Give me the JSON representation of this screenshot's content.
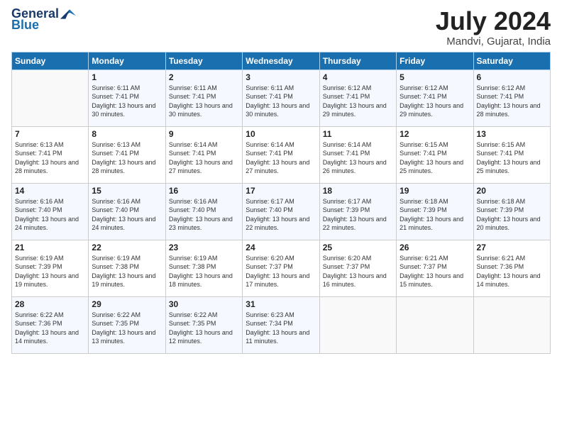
{
  "header": {
    "logo_line1": "General",
    "logo_line2": "Blue",
    "title": "July 2024",
    "location": "Mandvi, Gujarat, India"
  },
  "days_of_week": [
    "Sunday",
    "Monday",
    "Tuesday",
    "Wednesday",
    "Thursday",
    "Friday",
    "Saturday"
  ],
  "weeks": [
    [
      {
        "day": "",
        "sunrise": "",
        "sunset": "",
        "daylight": ""
      },
      {
        "day": "1",
        "sunrise": "Sunrise: 6:11 AM",
        "sunset": "Sunset: 7:41 PM",
        "daylight": "Daylight: 13 hours and 30 minutes."
      },
      {
        "day": "2",
        "sunrise": "Sunrise: 6:11 AM",
        "sunset": "Sunset: 7:41 PM",
        "daylight": "Daylight: 13 hours and 30 minutes."
      },
      {
        "day": "3",
        "sunrise": "Sunrise: 6:11 AM",
        "sunset": "Sunset: 7:41 PM",
        "daylight": "Daylight: 13 hours and 30 minutes."
      },
      {
        "day": "4",
        "sunrise": "Sunrise: 6:12 AM",
        "sunset": "Sunset: 7:41 PM",
        "daylight": "Daylight: 13 hours and 29 minutes."
      },
      {
        "day": "5",
        "sunrise": "Sunrise: 6:12 AM",
        "sunset": "Sunset: 7:41 PM",
        "daylight": "Daylight: 13 hours and 29 minutes."
      },
      {
        "day": "6",
        "sunrise": "Sunrise: 6:12 AM",
        "sunset": "Sunset: 7:41 PM",
        "daylight": "Daylight: 13 hours and 28 minutes."
      }
    ],
    [
      {
        "day": "7",
        "sunrise": "Sunrise: 6:13 AM",
        "sunset": "Sunset: 7:41 PM",
        "daylight": "Daylight: 13 hours and 28 minutes."
      },
      {
        "day": "8",
        "sunrise": "Sunrise: 6:13 AM",
        "sunset": "Sunset: 7:41 PM",
        "daylight": "Daylight: 13 hours and 28 minutes."
      },
      {
        "day": "9",
        "sunrise": "Sunrise: 6:14 AM",
        "sunset": "Sunset: 7:41 PM",
        "daylight": "Daylight: 13 hours and 27 minutes."
      },
      {
        "day": "10",
        "sunrise": "Sunrise: 6:14 AM",
        "sunset": "Sunset: 7:41 PM",
        "daylight": "Daylight: 13 hours and 27 minutes."
      },
      {
        "day": "11",
        "sunrise": "Sunrise: 6:14 AM",
        "sunset": "Sunset: 7:41 PM",
        "daylight": "Daylight: 13 hours and 26 minutes."
      },
      {
        "day": "12",
        "sunrise": "Sunrise: 6:15 AM",
        "sunset": "Sunset: 7:41 PM",
        "daylight": "Daylight: 13 hours and 25 minutes."
      },
      {
        "day": "13",
        "sunrise": "Sunrise: 6:15 AM",
        "sunset": "Sunset: 7:41 PM",
        "daylight": "Daylight: 13 hours and 25 minutes."
      }
    ],
    [
      {
        "day": "14",
        "sunrise": "Sunrise: 6:16 AM",
        "sunset": "Sunset: 7:40 PM",
        "daylight": "Daylight: 13 hours and 24 minutes."
      },
      {
        "day": "15",
        "sunrise": "Sunrise: 6:16 AM",
        "sunset": "Sunset: 7:40 PM",
        "daylight": "Daylight: 13 hours and 24 minutes."
      },
      {
        "day": "16",
        "sunrise": "Sunrise: 6:16 AM",
        "sunset": "Sunset: 7:40 PM",
        "daylight": "Daylight: 13 hours and 23 minutes."
      },
      {
        "day": "17",
        "sunrise": "Sunrise: 6:17 AM",
        "sunset": "Sunset: 7:40 PM",
        "daylight": "Daylight: 13 hours and 22 minutes."
      },
      {
        "day": "18",
        "sunrise": "Sunrise: 6:17 AM",
        "sunset": "Sunset: 7:39 PM",
        "daylight": "Daylight: 13 hours and 22 minutes."
      },
      {
        "day": "19",
        "sunrise": "Sunrise: 6:18 AM",
        "sunset": "Sunset: 7:39 PM",
        "daylight": "Daylight: 13 hours and 21 minutes."
      },
      {
        "day": "20",
        "sunrise": "Sunrise: 6:18 AM",
        "sunset": "Sunset: 7:39 PM",
        "daylight": "Daylight: 13 hours and 20 minutes."
      }
    ],
    [
      {
        "day": "21",
        "sunrise": "Sunrise: 6:19 AM",
        "sunset": "Sunset: 7:39 PM",
        "daylight": "Daylight: 13 hours and 19 minutes."
      },
      {
        "day": "22",
        "sunrise": "Sunrise: 6:19 AM",
        "sunset": "Sunset: 7:38 PM",
        "daylight": "Daylight: 13 hours and 19 minutes."
      },
      {
        "day": "23",
        "sunrise": "Sunrise: 6:19 AM",
        "sunset": "Sunset: 7:38 PM",
        "daylight": "Daylight: 13 hours and 18 minutes."
      },
      {
        "day": "24",
        "sunrise": "Sunrise: 6:20 AM",
        "sunset": "Sunset: 7:37 PM",
        "daylight": "Daylight: 13 hours and 17 minutes."
      },
      {
        "day": "25",
        "sunrise": "Sunrise: 6:20 AM",
        "sunset": "Sunset: 7:37 PM",
        "daylight": "Daylight: 13 hours and 16 minutes."
      },
      {
        "day": "26",
        "sunrise": "Sunrise: 6:21 AM",
        "sunset": "Sunset: 7:37 PM",
        "daylight": "Daylight: 13 hours and 15 minutes."
      },
      {
        "day": "27",
        "sunrise": "Sunrise: 6:21 AM",
        "sunset": "Sunset: 7:36 PM",
        "daylight": "Daylight: 13 hours and 14 minutes."
      }
    ],
    [
      {
        "day": "28",
        "sunrise": "Sunrise: 6:22 AM",
        "sunset": "Sunset: 7:36 PM",
        "daylight": "Daylight: 13 hours and 14 minutes."
      },
      {
        "day": "29",
        "sunrise": "Sunrise: 6:22 AM",
        "sunset": "Sunset: 7:35 PM",
        "daylight": "Daylight: 13 hours and 13 minutes."
      },
      {
        "day": "30",
        "sunrise": "Sunrise: 6:22 AM",
        "sunset": "Sunset: 7:35 PM",
        "daylight": "Daylight: 13 hours and 12 minutes."
      },
      {
        "day": "31",
        "sunrise": "Sunrise: 6:23 AM",
        "sunset": "Sunset: 7:34 PM",
        "daylight": "Daylight: 13 hours and 11 minutes."
      },
      {
        "day": "",
        "sunrise": "",
        "sunset": "",
        "daylight": ""
      },
      {
        "day": "",
        "sunrise": "",
        "sunset": "",
        "daylight": ""
      },
      {
        "day": "",
        "sunrise": "",
        "sunset": "",
        "daylight": ""
      }
    ]
  ]
}
